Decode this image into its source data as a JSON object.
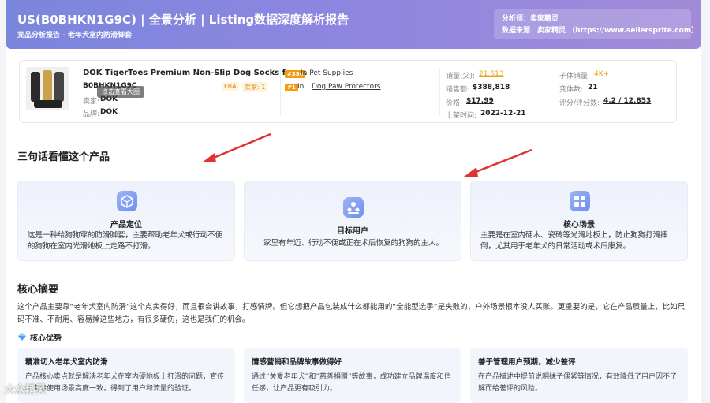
{
  "header": {
    "title": "US(B0BHKN1G9C) | 全景分析 | Listing数据深度解析报告",
    "subtitle": "竞品分析报告 - 老年犬室内防滑脚套",
    "analyst": "分析师：卖家精灵",
    "source": "数据来源：卖家精灵 （https://www.sellersprite.com）"
  },
  "product": {
    "name": "DOK TigerToes Premium Non-Slip Dog Socks for ...",
    "asin": "B0BHKN1G9C",
    "fba": "FBA",
    "sellers": "卖家: 1",
    "seller_label": "卖家:",
    "seller_value": "DOK",
    "brand_label": "品牌:",
    "brand_value": "DOK",
    "tooltip": "点击查看大图",
    "rank1_badge": "#354",
    "rank1_cat": "In Pet Supplies",
    "rank2_badge": "#1",
    "rank2_in": "In",
    "rank2_cat": "Dog Paw Protectors",
    "sales_label": "销量(父):",
    "sales_value": "21,613",
    "revenue_label": "销售额:",
    "revenue_value": "$388,818",
    "price_label": "价格:",
    "price_value": "$17.99",
    "launch_label": "上架时间:",
    "launch_value": "2022-12-21",
    "child_sales_label": "子体销量:",
    "child_sales_value": "4K+",
    "variants_label": "变体数:",
    "variants_value": "21",
    "rating_label": "评分/评分数:",
    "rating_value": "4.2 / 12,853"
  },
  "section1": {
    "title": "三句话看懂这个产品",
    "cards": [
      {
        "title": "产品定位",
        "text": "这是一种给狗狗穿的防滑脚套，主要帮助老年犬或行动不便的狗狗在室内光滑地板上走路不打滑。"
      },
      {
        "title": "目标用户",
        "text": "家里有年迈、行动不便或正在术后恢复的狗狗的主人。"
      },
      {
        "title": "核心场景",
        "text": "主要是在室内硬木、瓷砖等光滑地板上，防止狗狗打滑摔倒，尤其用于老年犬的日常活动或术后康复。"
      }
    ]
  },
  "section2": {
    "title": "核心摘要",
    "summary": "这个产品主要靠“老年犬室内防滑”这个点卖得好，而且很会讲故事，打感情牌。但它想把产品包装成什么都能用的“全能型选手”是失败的，户外场景根本没人买账。更重要的是，它在产品质量上，比如尺码不准、不耐用、容易掉这些地方，有很多硬伤，这也是我们的机会。",
    "adv_title": "核心优势",
    "adv_cards": [
      {
        "title": "精准切入老年犬室内防滑",
        "text": "产品核心卖点就是解决老年犬在室内硬地板上打滑的问题，宣传和实际使用场景高度一致，得到了用户和流量的验证。"
      },
      {
        "title": "情感营销和品牌故事做得好",
        "text": "通过“关爱老年犬”和“慈善捐赠”等故事，成功建立品牌温度和信任感，让产品更有吸引力。"
      },
      {
        "title": "善于管理用户预期，减少差评",
        "text": "在产品描述中提前说明袜子偶紧等情况，有效降低了用户因不了解而给差评的风险。"
      }
    ]
  },
  "watermark": "大众精灵",
  "colors": {
    "accent": "#7a86dc",
    "orange": "#e8a317",
    "arrow": "#e0332f"
  }
}
